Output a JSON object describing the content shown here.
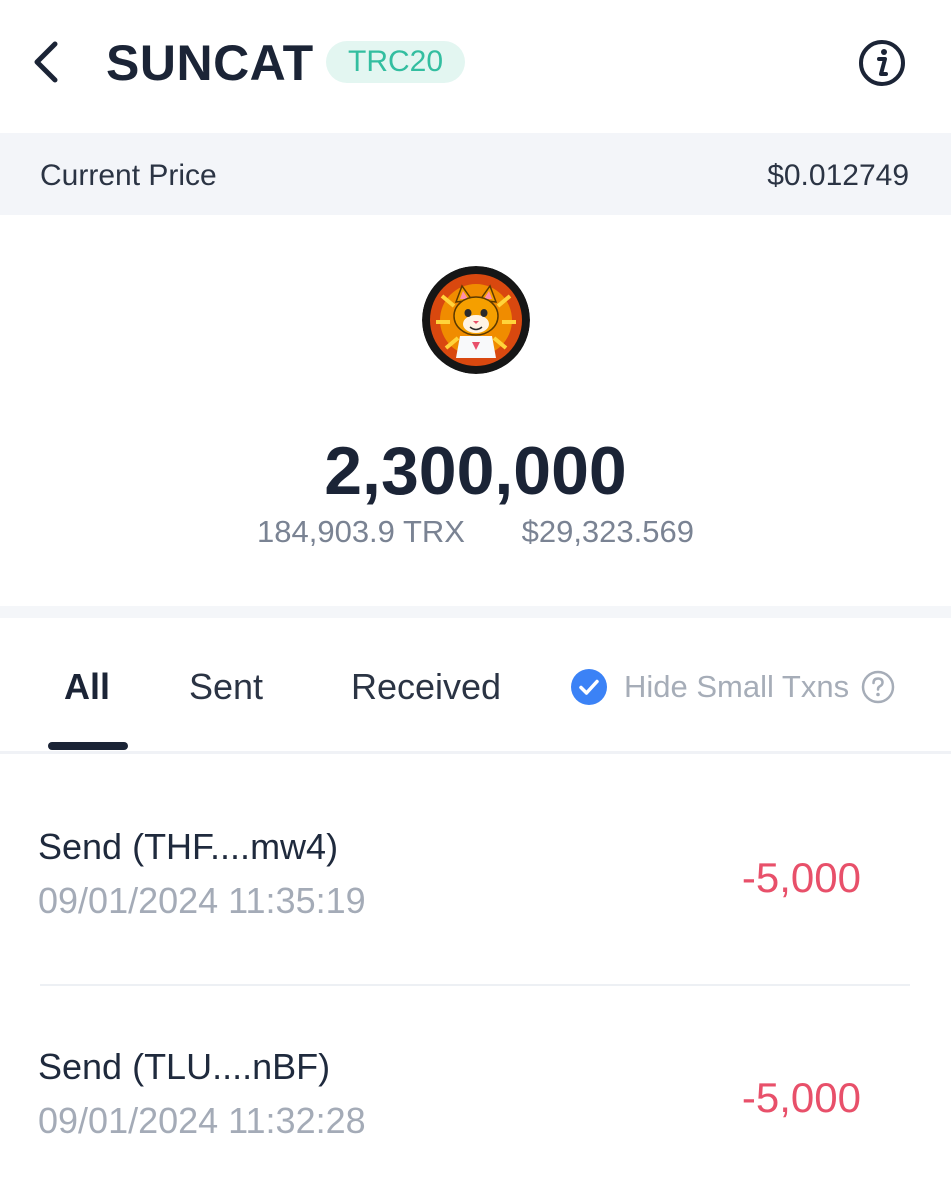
{
  "header": {
    "title": "SUNCAT",
    "badge": "TRC20"
  },
  "price": {
    "label": "Current Price",
    "value": "$0.012749"
  },
  "balance": {
    "amount": "2,300,000",
    "trx_value": "184,903.9  TRX",
    "usd_value": "$29,323.569"
  },
  "tabs": [
    {
      "label": "All",
      "active": true
    },
    {
      "label": "Sent",
      "active": false
    },
    {
      "label": "Received",
      "active": false
    }
  ],
  "filter": {
    "hide_small_label": "Hide Small Txns",
    "checked": true
  },
  "transactions": [
    {
      "title": "Send (THF....mw4)",
      "time": "09/01/2024  11:35:19",
      "amount": "-5,000"
    },
    {
      "title": "Send (TLU....nBF)",
      "time": "09/01/2024  11:32:28",
      "amount": "-5,000"
    }
  ],
  "colors": {
    "accent": "#33bea0",
    "negative": "#e8506a",
    "check": "#3b82f6"
  },
  "icons": {
    "back": "chevron-left-icon",
    "info": "info-icon",
    "check": "check-circle-icon",
    "help": "question-circle-icon"
  }
}
